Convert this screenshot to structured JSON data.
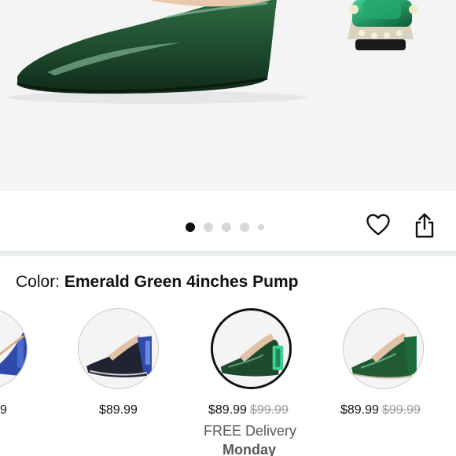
{
  "product_image": {
    "alt": "Emerald Green pointed-toe patent pump with jeweled heel",
    "carousel": {
      "total_dots": 5,
      "active_index": 0
    }
  },
  "actions": {
    "wishlist_icon": "heart-icon",
    "share_icon": "share-icon"
  },
  "variation": {
    "label_prefix": "Color: ",
    "selected_value": "Emerald Green 4inches Pump",
    "swatches": [
      {
        "name": "blue-swatch-partial",
        "price": "9",
        "list_price": "",
        "selected": false
      },
      {
        "name": "black-blue-swatch",
        "price": "$89.99",
        "list_price": "",
        "selected": false
      },
      {
        "name": "emerald-green-swatch",
        "price": "$89.99",
        "list_price": "$99.99",
        "selected": true
      },
      {
        "name": "green-swatch",
        "price": "$89.99",
        "list_price": "$99.99",
        "selected": false
      }
    ],
    "delivery_text": "FREE Delivery",
    "delivery_day": "Monday"
  },
  "colors": {
    "shoe_green": "#1d4a2c",
    "heel_blue": "#2f4aa8",
    "jewel_green": "#1b8a5a",
    "accent_dark": "#0f1111"
  }
}
